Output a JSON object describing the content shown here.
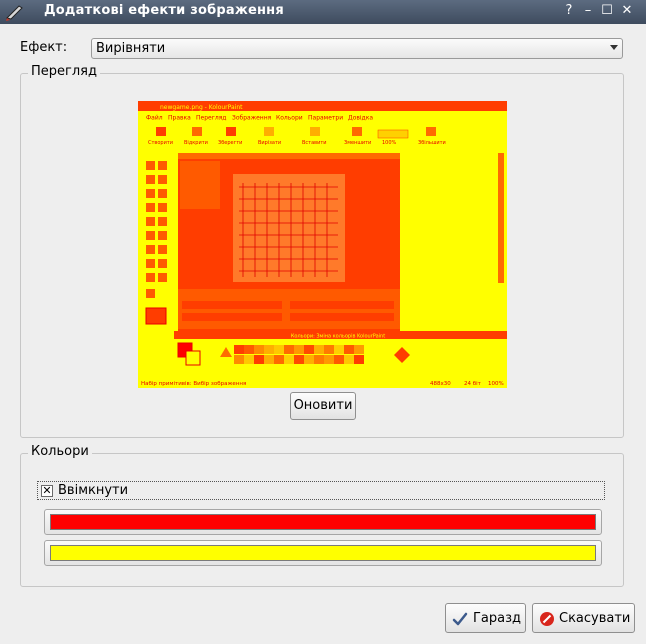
{
  "window": {
    "title": "Додаткові ефекти зображення",
    "help_glyph": "?",
    "minimize_glyph": "–",
    "maximize_glyph": "☐",
    "close_glyph": "✕"
  },
  "effect": {
    "label": "Ефект:",
    "selected": "Вирівняти"
  },
  "preview": {
    "legend": "Перегляд",
    "refresh_label": "Оновити"
  },
  "colors": {
    "legend": "Кольори",
    "enabled_label": "Ввімкнути",
    "enabled_checked": true,
    "check_glyph": "✕",
    "color1": "#ff0000",
    "color2": "#ffff00"
  },
  "buttons": {
    "ok_label": "Гаразд",
    "cancel_label": "Скасувати"
  },
  "preview_screenshot": {
    "title": "newgame.png - KolourPaint",
    "menu": [
      "Файл",
      "Правка",
      "Перегляд",
      "Зображення",
      "Кольори",
      "Параметри",
      "Довідка"
    ],
    "toolbar": [
      "Створити",
      "Відкрити",
      "Зберегти",
      "Вирізати",
      "Вставити",
      "Зменшити",
      "100%",
      "Збільшити"
    ],
    "status_left": "Набір примітивів: Вибір зображення",
    "status_right": [
      "488x30",
      "24 біт",
      "100%"
    ],
    "palette_banner": "Кольори: Зміна кольорів KolourPaint"
  }
}
